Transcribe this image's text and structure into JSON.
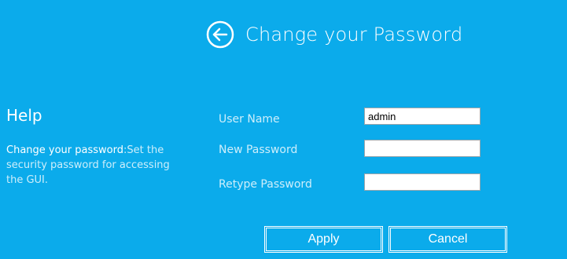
{
  "header": {
    "title": "Change your Password",
    "back_icon": "arrow-left-circle-icon"
  },
  "help": {
    "title": "Help",
    "strong": "Change your password",
    "text": ":Set the security password for accessing the GUI."
  },
  "form": {
    "username_label": "User Name",
    "username_value": "admin",
    "new_password_label": "New Password",
    "new_password_value": "",
    "retype_password_label": "Retype Password",
    "retype_password_value": ""
  },
  "buttons": {
    "apply": "Apply",
    "cancel": "Cancel"
  },
  "colors": {
    "background": "#0babeb",
    "text": "#ffffff",
    "muted_text": "#cdeefb"
  }
}
